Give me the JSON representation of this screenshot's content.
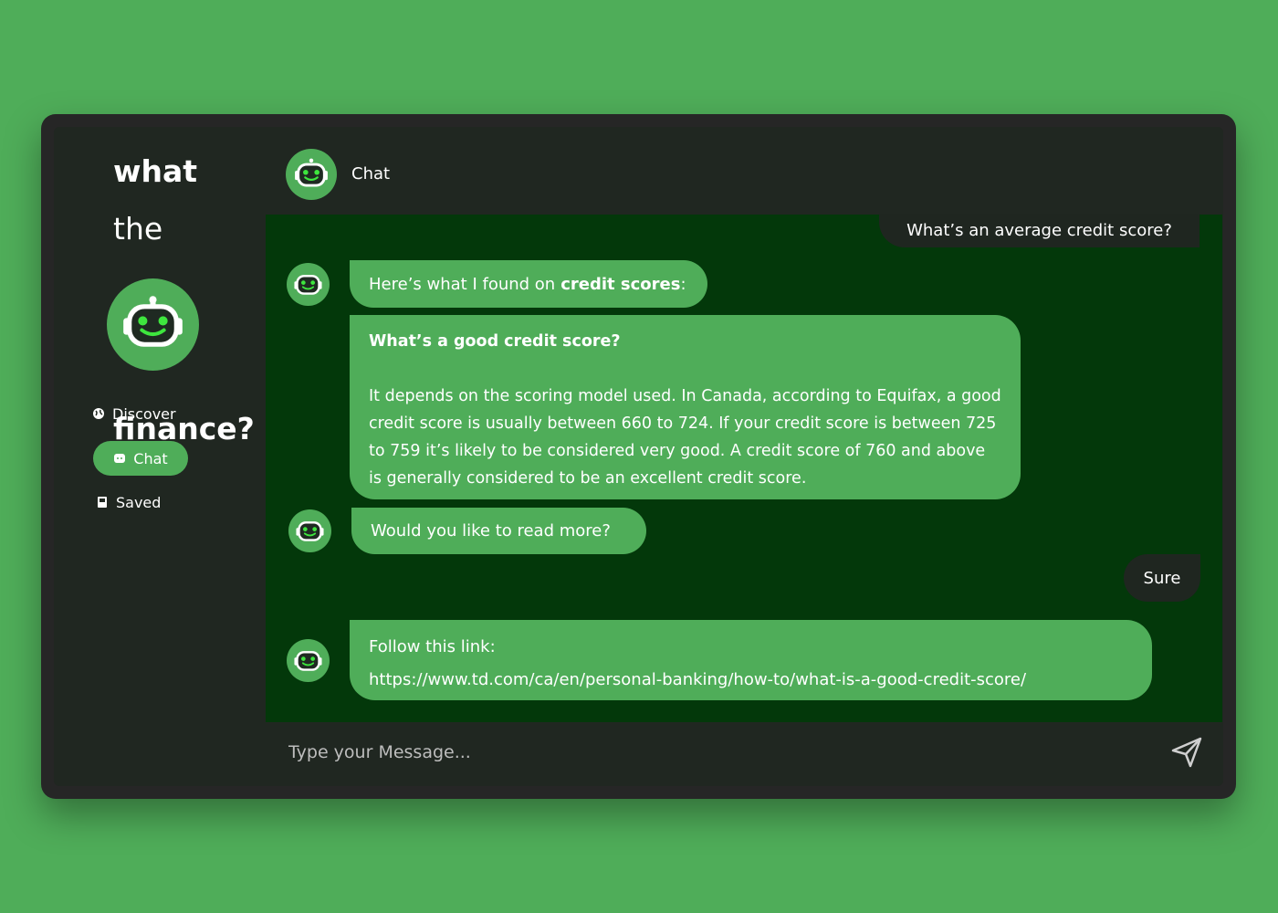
{
  "brand": {
    "line1": "what",
    "line2": "the",
    "line3": "finance?"
  },
  "sidebar": {
    "items": [
      {
        "label": "Discover",
        "icon": "globe-icon"
      },
      {
        "label": "Chat",
        "icon": "chat-icon",
        "active": true
      },
      {
        "label": "Saved",
        "icon": "bookmark-icon"
      }
    ]
  },
  "header": {
    "title": "Chat"
  },
  "messages": {
    "user1": "What’s an average credit score?",
    "bot1_prefix": "Here’s what I found on",
    "bot1_bold": "credit scores",
    "bot1_suffix": ":",
    "bot2_title": "What’s a good credit score?",
    "bot2_body": "It depends on the scoring model used. In Canada, according to Equifax, a good credit score is usually between 660 to 724. If your credit score is between 725 to 759 it’s likely to be considered very good. A credit score of 760 and above is generally considered to be an excellent credit score.",
    "bot3": "Would you like to read more?",
    "user2": "Sure",
    "bot4_label": "Follow this link:",
    "bot4_link": "https://www.td.com/ca/en/personal-banking/how-to/what-is-a-good-credit-score/"
  },
  "input": {
    "placeholder": "Type your Message..."
  },
  "colors": {
    "background": "#4fad59",
    "panel": "#202721",
    "chat_bg": "#03380a",
    "bot_bubble": "#4fad59",
    "user_bubble": "#1f2620"
  }
}
